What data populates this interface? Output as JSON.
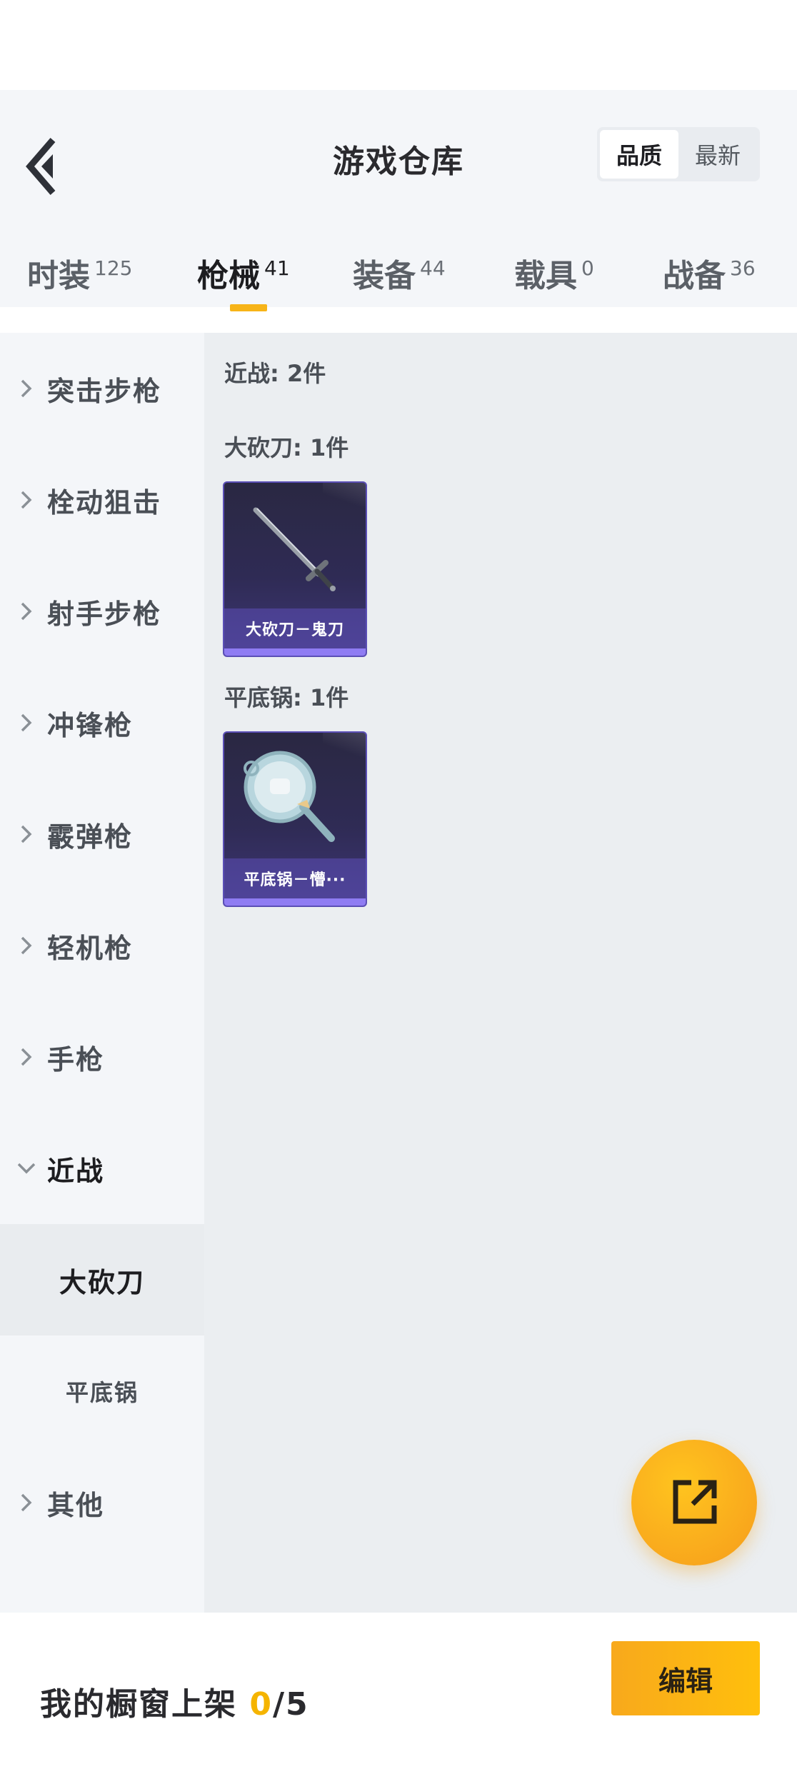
{
  "header": {
    "title": "游戏仓库",
    "sort_options": [
      "品质",
      "最新"
    ]
  },
  "tabs": [
    {
      "label": "时装",
      "count": "125"
    },
    {
      "label": "枪械",
      "count": "41"
    },
    {
      "label": "装备",
      "count": "44"
    },
    {
      "label": "载具",
      "count": "0"
    },
    {
      "label": "战备",
      "count": "36"
    }
  ],
  "active_tab": "枪械",
  "sidebar": {
    "categories": [
      "突击步枪",
      "栓动狙击",
      "射手步枪",
      "冲锋枪",
      "霰弹枪",
      "轻机枪",
      "手枪",
      "近战"
    ],
    "subcategories": [
      "大砍刀",
      "平底锅"
    ],
    "other": "其他"
  },
  "content": {
    "summary": "近战: 2件",
    "groups": [
      {
        "title": "大砍刀: 1件",
        "item_name": "大砍刀－鬼刀"
      },
      {
        "title": "平底锅: 1件",
        "item_name": "平底锅－懵···"
      }
    ]
  },
  "footer": {
    "showcase_label": "我的橱窗上架",
    "showcase_count": "0",
    "showcase_total": "/5",
    "edit_label": "编辑"
  },
  "colors": {
    "accent": "#f7b418",
    "card_rarity": "#8f7cf3"
  }
}
